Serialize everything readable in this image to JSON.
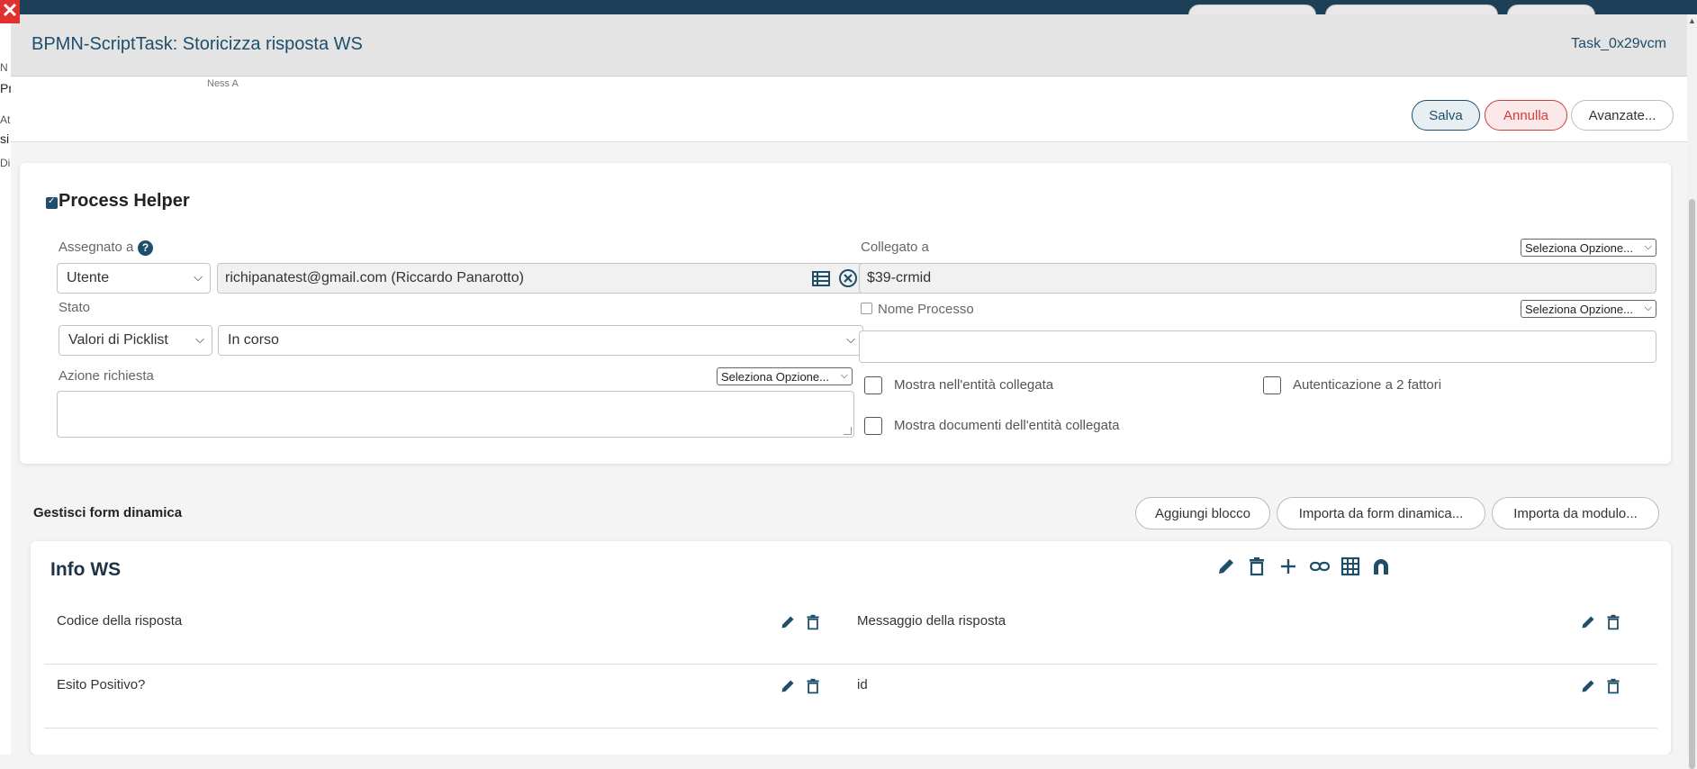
{
  "background": {
    "left_labels": [
      "N",
      "Pr",
      "At",
      "si",
      "Di"
    ],
    "obscured_text": "Ness A"
  },
  "modal": {
    "title": "BPMN-ScriptTask: Storicizza risposta WS",
    "task_id": "Task_0x29vcm",
    "close_label": "✕"
  },
  "actions": {
    "save": "Salva",
    "cancel": "Annulla",
    "advanced": "Avanzate..."
  },
  "process_helper": {
    "title": "Process Helper",
    "enabled": true,
    "assigned_label": "Assegnato a",
    "assigned_type": "Utente",
    "assigned_value": "richipanatest@gmail.com (Riccardo Panarotto)",
    "linked_label": "Collegato a",
    "linked_option": "Seleziona Opzione...",
    "linked_value": "$39-crmid",
    "status_label": "Stato",
    "status_source": "Valori di Picklist",
    "status_value": "In corso",
    "process_name_label": "Nome Processo",
    "process_name_option": "Seleziona Opzione...",
    "process_name_value": "",
    "action_label": "Azione richiesta",
    "action_option": "Seleziona Opzione...",
    "action_value": "",
    "show_in_linked": "Mostra nell'entità collegata",
    "two_factor": "Autenticazione a 2 fattori",
    "show_docs": "Mostra documenti dell'entità collegata"
  },
  "dynamic_form": {
    "label": "Gestisci form dinamica",
    "add_block": "Aggiungi blocco",
    "import_form": "Importa da form dinamica...",
    "import_module": "Importa da modulo..."
  },
  "block": {
    "title": "Info WS",
    "fields": [
      {
        "label": "Codice della risposta"
      },
      {
        "label": "Messaggio della risposta"
      },
      {
        "label": "Esito Positivo?"
      },
      {
        "label": "id"
      }
    ]
  },
  "colors": {
    "primary": "#1f4e6b",
    "danger": "#d43b3b",
    "header_bg": "#e4e4e4"
  }
}
